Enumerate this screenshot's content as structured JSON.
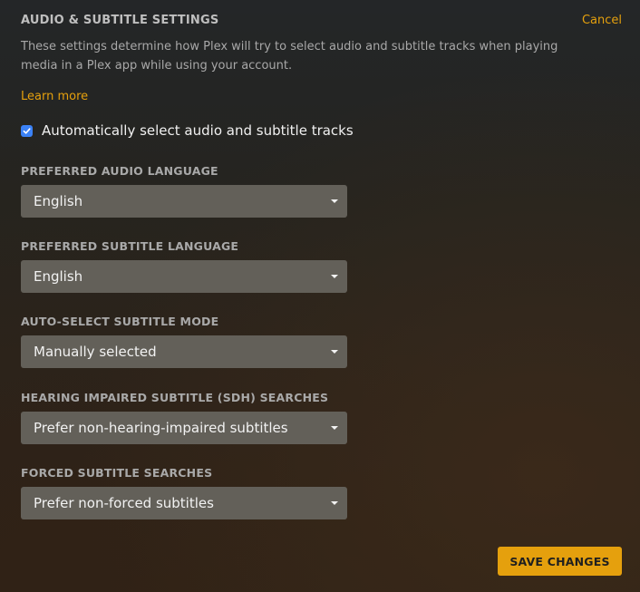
{
  "header": {
    "title": "AUDIO & SUBTITLE SETTINGS",
    "cancel_label": "Cancel"
  },
  "description": "These settings determine how Plex will try to select audio and subtitle tracks when playing media in a Plex app while using your account.",
  "learn_more_label": "Learn more",
  "auto_select": {
    "label": "Automatically select audio and subtitle tracks",
    "checked": true
  },
  "fields": [
    {
      "label": "PREFERRED AUDIO LANGUAGE",
      "value": "English"
    },
    {
      "label": "PREFERRED SUBTITLE LANGUAGE",
      "value": "English"
    },
    {
      "label": "AUTO-SELECT SUBTITLE MODE",
      "value": "Manually selected"
    },
    {
      "label": "HEARING IMPAIRED SUBTITLE (SDH) SEARCHES",
      "value": "Prefer non-hearing-impaired subtitles"
    },
    {
      "label": "FORCED SUBTITLE SEARCHES",
      "value": "Prefer non-forced subtitles"
    }
  ],
  "save_label": "SAVE CHANGES",
  "colors": {
    "accent": "#e5a00d",
    "checkbox": "#3b82f6",
    "select_bg": "#636059"
  },
  "icons": {
    "checkbox": "check-icon",
    "select": "caret-down-icon"
  }
}
